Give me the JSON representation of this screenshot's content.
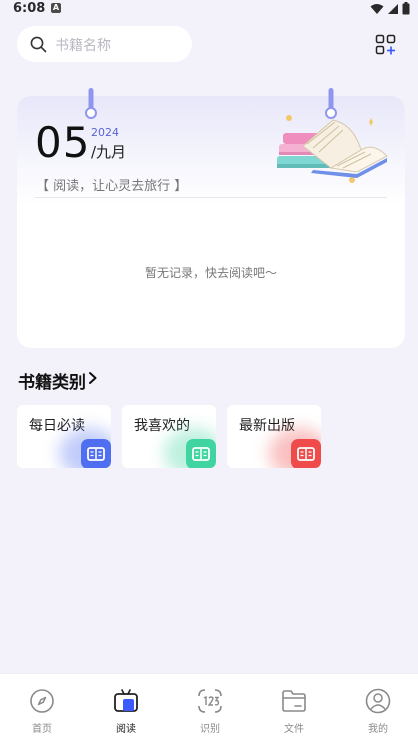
{
  "status": {
    "time": "6:08",
    "notification_letter": "A"
  },
  "search": {
    "placeholder": "书籍名称"
  },
  "calendar": {
    "day": "05",
    "year": "2024",
    "month": "/九月",
    "motto": "【 阅读，让心灵去旅行 】",
    "empty_text": "暂无记录，快去阅读吧～"
  },
  "categories": {
    "title": "书籍类别",
    "items": [
      {
        "label": "每日必读",
        "color": "#4f6ef0"
      },
      {
        "label": "我喜欢的",
        "color": "#3fd4a0"
      },
      {
        "label": "最新出版",
        "color": "#ef4b4b"
      }
    ]
  },
  "tabs": [
    {
      "label": "首页",
      "icon": "compass-icon"
    },
    {
      "label": "阅读",
      "icon": "tv-icon",
      "active": true
    },
    {
      "label": "识别",
      "icon": "scan-icon"
    },
    {
      "label": "文件",
      "icon": "folder-icon"
    },
    {
      "label": "我的",
      "icon": "user-icon"
    }
  ],
  "colors": {
    "accent": "#5a63d6",
    "background": "#f3f2fb"
  }
}
